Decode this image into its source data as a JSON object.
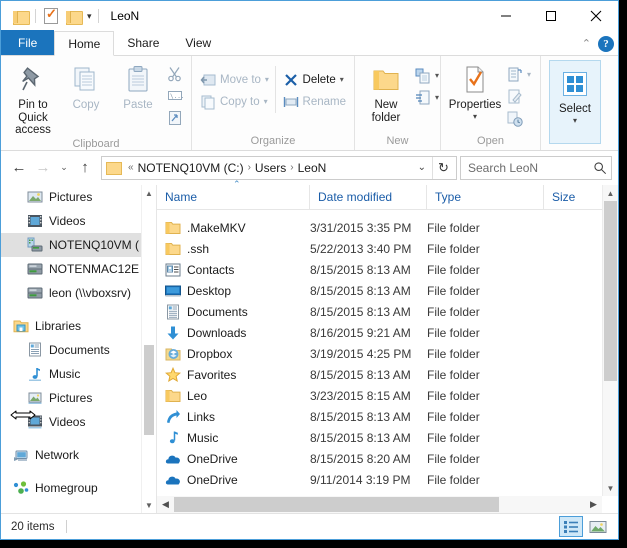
{
  "window": {
    "title": "LeoN",
    "quick_access": [
      {
        "name": "folder-icon",
        "label": "Properties quick access"
      },
      {
        "name": "properties-icon",
        "label": "Properties"
      },
      {
        "name": "new-folder-icon",
        "label": "New folder"
      }
    ],
    "controls": {
      "minimize": "minimize-button",
      "maximize": "maximize-button",
      "close": "close-button"
    }
  },
  "ribbon": {
    "tabs": [
      {
        "label": "File",
        "active": false,
        "is_file": true
      },
      {
        "label": "Home",
        "active": true,
        "is_file": false
      },
      {
        "label": "Share",
        "active": false,
        "is_file": false
      },
      {
        "label": "View",
        "active": false,
        "is_file": false
      }
    ],
    "collapse_label": "⌃",
    "help_label": "?",
    "groups": [
      {
        "label": "Clipboard",
        "buttons": [
          {
            "label": "Pin to Quick access",
            "icon": "pin-icon",
            "enabled": true
          },
          {
            "label": "Copy",
            "icon": "copy-icon",
            "enabled": false
          },
          {
            "label": "Paste",
            "icon": "paste-icon",
            "enabled": false
          }
        ],
        "small_buttons": [
          {
            "label": "Cut",
            "icon": "scissors-icon"
          },
          {
            "label": "Copy path",
            "icon": "copy-path-icon"
          },
          {
            "label": "Paste shortcut",
            "icon": "paste-shortcut-icon"
          }
        ]
      },
      {
        "label": "Organize",
        "small_buttons": [
          {
            "label": "Move to",
            "icon": "move-to-icon",
            "has_caret": true
          },
          {
            "label": "Copy to",
            "icon": "copy-to-icon",
            "has_caret": true
          },
          {
            "label": "Delete",
            "icon": "delete-x-icon",
            "has_caret": true
          },
          {
            "label": "Rename",
            "icon": "rename-icon",
            "has_caret": false
          }
        ]
      },
      {
        "label": "New",
        "buttons": [
          {
            "label": "New folder",
            "icon": "new-folder-icon",
            "enabled": true
          }
        ],
        "small_buttons": [
          {
            "label": "New item",
            "icon": "new-item-icon",
            "has_caret": true
          },
          {
            "label": "Easy access",
            "icon": "easy-access-icon",
            "has_caret": true
          }
        ]
      },
      {
        "label": "Open",
        "buttons": [
          {
            "label": "Properties",
            "icon": "properties-icon",
            "enabled": true,
            "has_caret": true
          }
        ],
        "small_buttons": [
          {
            "label": "Open",
            "icon": "open-icon",
            "has_caret": true
          },
          {
            "label": "Edit",
            "icon": "edit-icon",
            "has_caret": false
          },
          {
            "label": "History",
            "icon": "history-icon",
            "has_caret": false
          }
        ]
      },
      {
        "label": "",
        "buttons": [
          {
            "label": "Select",
            "icon": "select-icon",
            "enabled": true,
            "selected": true,
            "has_caret": true
          }
        ]
      }
    ]
  },
  "address_bar": {
    "back": "←",
    "forward": "→",
    "recent": "⌄",
    "up": "↑",
    "overflow": "«",
    "crumbs": [
      "NOTENQ10VM (C:)",
      "Users",
      "LeoN"
    ],
    "crumb_separator": "›",
    "dropdown": "⌄",
    "refresh": "↻",
    "search_placeholder": "Search LeoN"
  },
  "nav_pane": {
    "items": [
      {
        "label": "Pictures",
        "icon": "pictures-icon",
        "level": 1,
        "highlighted": false
      },
      {
        "label": "Videos",
        "icon": "videos-icon",
        "level": 1,
        "highlighted": false
      },
      {
        "label": "NOTENQ10VM (",
        "icon": "computer-icon",
        "level": 1,
        "highlighted": true
      },
      {
        "label": "NOTENMAC12E",
        "icon": "network-computer-icon",
        "level": 1,
        "highlighted": false
      },
      {
        "label": "leon (\\\\vboxsrv)",
        "icon": "network-computer-icon",
        "level": 1,
        "highlighted": false
      },
      {
        "label": "Libraries",
        "icon": "libraries-icon",
        "level": 0,
        "highlighted": false,
        "gap_before": true
      },
      {
        "label": "Documents",
        "icon": "documents-library-icon",
        "level": 1,
        "highlighted": false
      },
      {
        "label": "Music",
        "icon": "music-library-icon",
        "level": 1,
        "highlighted": false
      },
      {
        "label": "Pictures",
        "icon": "pictures-library-icon",
        "level": 1,
        "highlighted": false
      },
      {
        "label": "Videos",
        "icon": "videos-library-icon",
        "level": 1,
        "highlighted": false
      },
      {
        "label": "Network",
        "icon": "network-icon",
        "level": 0,
        "highlighted": false,
        "gap_before": true
      },
      {
        "label": "Homegroup",
        "icon": "homegroup-icon",
        "level": 0,
        "highlighted": false,
        "gap_before": true
      }
    ]
  },
  "file_list": {
    "columns": [
      "Name",
      "Date modified",
      "Type",
      "Size"
    ],
    "sort_column": "Name",
    "sort_direction": "ascending",
    "rows": [
      {
        "name": ".MakeMKV",
        "date": "3/31/2015 3:35 PM",
        "type": "File folder",
        "size": "",
        "icon": "folder-icon"
      },
      {
        "name": ".ssh",
        "date": "5/22/2013 3:40 PM",
        "type": "File folder",
        "size": "",
        "icon": "folder-icon"
      },
      {
        "name": "Contacts",
        "date": "8/15/2015 8:13 AM",
        "type": "File folder",
        "size": "",
        "icon": "contacts-icon"
      },
      {
        "name": "Desktop",
        "date": "8/15/2015 8:13 AM",
        "type": "File folder",
        "size": "",
        "icon": "desktop-icon"
      },
      {
        "name": "Documents",
        "date": "8/15/2015 8:13 AM",
        "type": "File folder",
        "size": "",
        "icon": "documents-icon"
      },
      {
        "name": "Downloads",
        "date": "8/16/2015 9:21 AM",
        "type": "File folder",
        "size": "",
        "icon": "downloads-icon"
      },
      {
        "name": "Dropbox",
        "date": "3/19/2015 4:25 PM",
        "type": "File folder",
        "size": "",
        "icon": "dropbox-icon"
      },
      {
        "name": "Favorites",
        "date": "8/15/2015 8:13 AM",
        "type": "File folder",
        "size": "",
        "icon": "favorites-star-icon"
      },
      {
        "name": "Leo",
        "date": "3/23/2015 8:15 AM",
        "type": "File folder",
        "size": "",
        "icon": "folder-icon"
      },
      {
        "name": "Links",
        "date": "8/15/2015 8:13 AM",
        "type": "File folder",
        "size": "",
        "icon": "links-icon"
      },
      {
        "name": "Music",
        "date": "8/15/2015 8:13 AM",
        "type": "File folder",
        "size": "",
        "icon": "music-note-icon"
      },
      {
        "name": "OneDrive",
        "date": "8/15/2015 8:20 AM",
        "type": "File folder",
        "size": "",
        "icon": "onedrive-icon"
      },
      {
        "name": "OneDrive",
        "date": "9/11/2014 3:19 PM",
        "type": "File folder",
        "size": "",
        "icon": "onedrive-icon"
      }
    ]
  },
  "status_bar": {
    "item_count": "20 items",
    "views": [
      {
        "name": "details-view-button",
        "selected": true
      },
      {
        "name": "large-icons-view-button",
        "selected": false
      }
    ]
  },
  "colors": {
    "accent": "#1b74bd",
    "selection": "#cfe8f8",
    "folder": "#fcd88b",
    "header_text": "#1b5da8"
  }
}
